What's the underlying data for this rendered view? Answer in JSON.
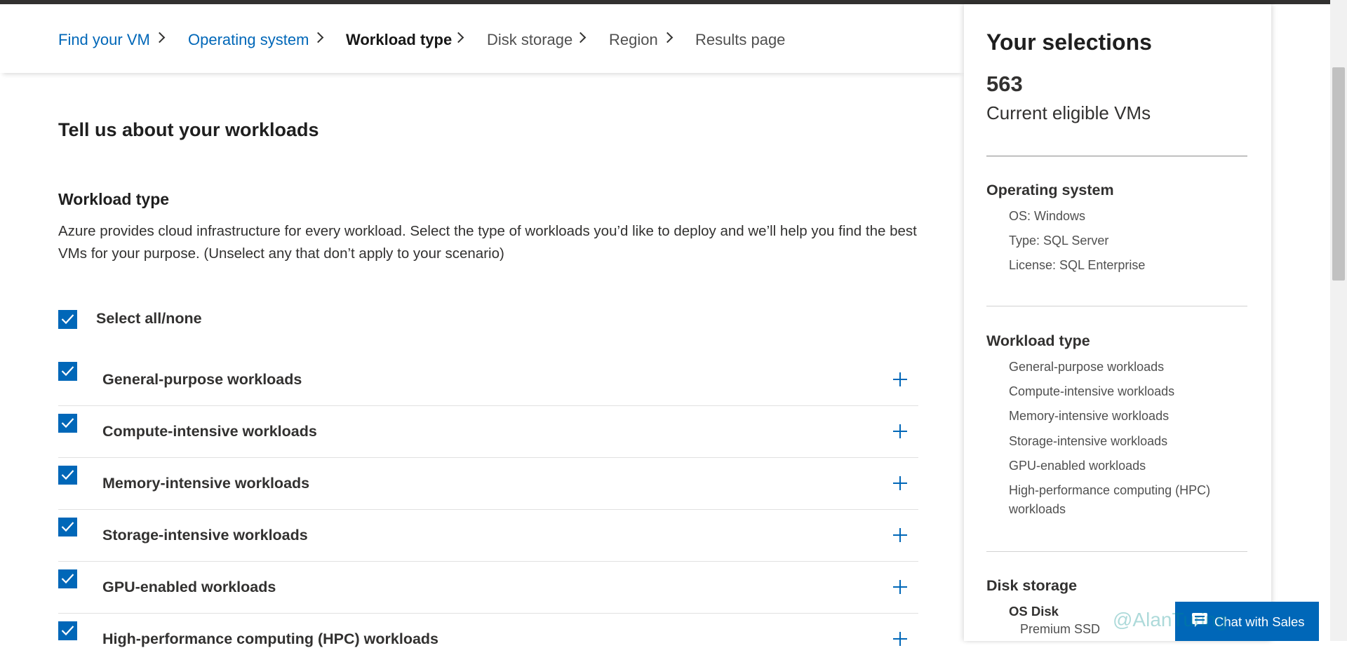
{
  "breadcrumb": [
    {
      "label": "Find your VM",
      "state": "link"
    },
    {
      "label": "Operating system",
      "state": "link"
    },
    {
      "label": "Workload type",
      "state": "current"
    },
    {
      "label": "Disk storage",
      "state": "future"
    },
    {
      "label": "Region",
      "state": "future"
    },
    {
      "label": "Results page",
      "state": "future"
    }
  ],
  "main": {
    "title": "Tell us about your workloads",
    "section_title": "Workload type",
    "description": "Azure provides cloud infrastructure for every workload. Select the type of workloads you’d like to deploy and we’ll help you find the best VMs for your purpose. (Unselect any that don’t apply to your scenario)",
    "select_all": {
      "label": "Select all/none",
      "checked": true
    },
    "workloads": [
      {
        "label": "General-purpose workloads",
        "checked": true,
        "expand_icon": "plus-icon"
      },
      {
        "label": "Compute-intensive workloads",
        "checked": true,
        "expand_icon": "plus-icon"
      },
      {
        "label": "Memory-intensive workloads",
        "checked": true,
        "expand_icon": "plus-icon"
      },
      {
        "label": "Storage-intensive workloads",
        "checked": true,
        "expand_icon": "plus-icon"
      },
      {
        "label": "GPU-enabled workloads",
        "checked": true,
        "expand_icon": "plus-icon"
      },
      {
        "label": "High-performance computing (HPC) workloads",
        "checked": true,
        "expand_icon": "plus-icon"
      }
    ]
  },
  "sidebar": {
    "title": "Your selections",
    "count": "563",
    "count_label": "Current eligible VMs",
    "operating_system": {
      "heading": "Operating system",
      "items": [
        "OS: Windows",
        "Type: SQL Server",
        "License: SQL Enterprise"
      ]
    },
    "workload_type": {
      "heading": "Workload type",
      "items": [
        "General-purpose workloads",
        "Compute-intensive workloads",
        "Memory-intensive workloads",
        "Storage-intensive workloads",
        "GPU-enabled workloads",
        "High-performance computing (HPC) workloads"
      ]
    },
    "disk_storage": {
      "heading": "Disk storage",
      "sub_heading": "OS Disk",
      "items": [
        "Premium SSD"
      ]
    }
  },
  "chat": {
    "label": "Chat with Sales",
    "icon": "chat-icon"
  },
  "watermark": "@AlanTuring",
  "colors": {
    "link": "#0067b8",
    "checkbox": "#0067b8",
    "text": "#323130",
    "topbar": "#323130"
  }
}
